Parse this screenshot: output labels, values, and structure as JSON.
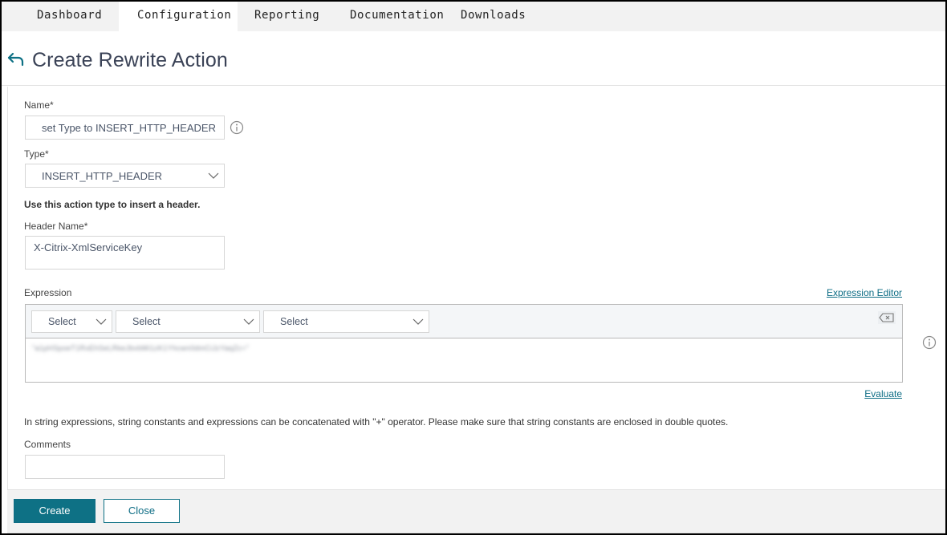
{
  "tabs": [
    {
      "label": "Dashboard",
      "active": false
    },
    {
      "label": "Configuration",
      "active": true
    },
    {
      "label": "Reporting",
      "active": false
    },
    {
      "label": "Documentation",
      "active": false
    },
    {
      "label": "Downloads",
      "active": false
    }
  ],
  "page": {
    "title": "Create Rewrite Action",
    "back_icon": "back-arrow-icon"
  },
  "form": {
    "name": {
      "label": "Name*",
      "value": "set Type to INSERT_HTTP_HEADER"
    },
    "type": {
      "label": "Type*",
      "value": "INSERT_HTTP_HEADER"
    },
    "type_hint": "Use this action type to insert a header.",
    "header_name": {
      "label": "Header Name*",
      "value": "X-Citrix-XmlServiceKey"
    },
    "expression": {
      "label": "Expression",
      "editor_link": "Expression Editor",
      "selects": [
        "Select",
        "Select",
        "Select"
      ],
      "value": "\"a1pHSpoeT1RxEhSeLRkeJbvbMi1zK1Yhcwn0dmCiJzYaqZc=\"",
      "value_blurred": true,
      "evaluate_link": "Evaluate"
    },
    "expression_note": "In string expressions, string constants and expressions can be concatenated with \"+\" operator. Please make sure that string constants are enclosed in double quotes.",
    "comments": {
      "label": "Comments",
      "value": ""
    }
  },
  "footer": {
    "create_label": "Create",
    "close_label": "Close"
  },
  "colors": {
    "accent": "#0e7185",
    "link": "#0e6d85",
    "tabbar_bg": "#f2f2f2",
    "title": "#3a4256"
  }
}
